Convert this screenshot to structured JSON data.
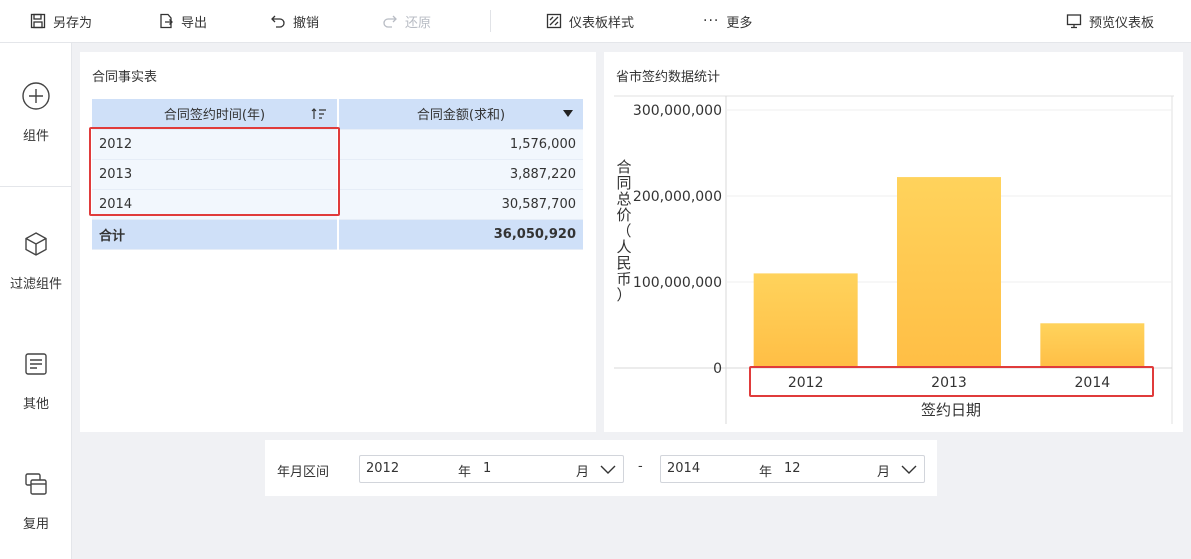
{
  "toolbar": {
    "save_as": "另存为",
    "export": "导出",
    "undo": "撤销",
    "redo": "还原",
    "dashboard_style": "仪表板样式",
    "more": "更多",
    "preview": "预览仪表板"
  },
  "sidebar": {
    "items": [
      {
        "label": "组件",
        "icon": "plus-circle-icon"
      },
      {
        "label": "过滤组件",
        "icon": "cube-icon"
      },
      {
        "label": "其他",
        "icon": "document-icon"
      },
      {
        "label": "复用",
        "icon": "reuse-icon"
      }
    ]
  },
  "table_panel": {
    "title": "合同事实表",
    "headers": [
      "合同签约时间(年)",
      "合同金额(求和)"
    ],
    "rows": [
      {
        "year": "2012",
        "amount": "1,576,000"
      },
      {
        "year": "2013",
        "amount": "3,887,220"
      },
      {
        "year": "2014",
        "amount": "30,587,700"
      }
    ],
    "total": {
      "label": "合计",
      "amount": "36,050,920"
    }
  },
  "chart_panel": {
    "title": "省市签约数据统计"
  },
  "chart_data": {
    "type": "bar",
    "categories": [
      "2012",
      "2013",
      "2014"
    ],
    "values": [
      110000000,
      222000000,
      52000000
    ],
    "ylim": [
      0,
      300000000
    ],
    "yticks": [
      "300,000,000",
      "200,000,000",
      "100,000,000",
      "0"
    ],
    "ytick_values": [
      300000000,
      200000000,
      100000000,
      0
    ],
    "xlabel": "签约日期",
    "ylabel": "合同总价（人民币）",
    "bar_color_top": "#ffd35c",
    "bar_color_bottom": "#ffbe45",
    "grid": true
  },
  "filter": {
    "label": "年月区间",
    "start": {
      "year": "2012",
      "year_unit": "年",
      "month": "1",
      "month_unit": "月"
    },
    "separator": "-",
    "end": {
      "year": "2014",
      "year_unit": "年",
      "month": "12",
      "month_unit": "月"
    }
  }
}
